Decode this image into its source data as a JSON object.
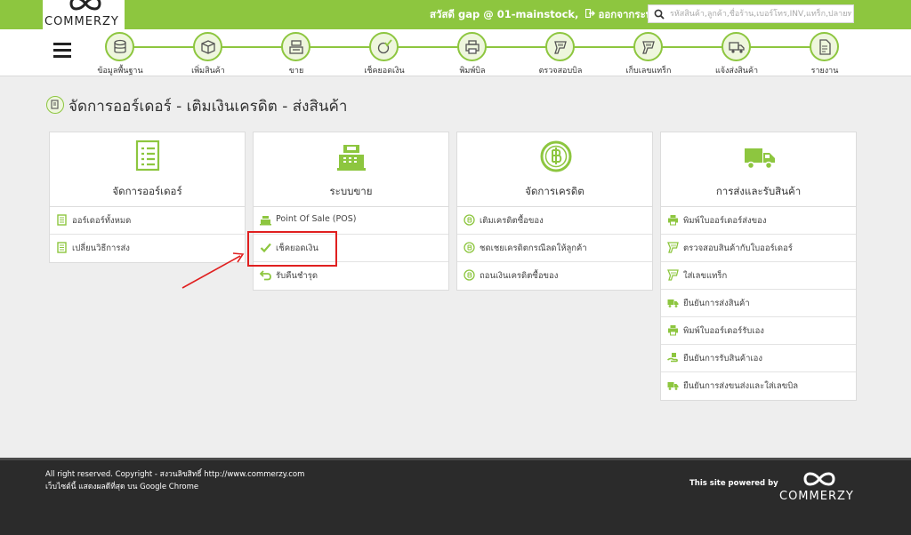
{
  "header": {
    "logo_text": "COMMERZY",
    "greeting": "สวัสดี gap @ 01-mainstock,",
    "logout": "ออกจากระบบ",
    "search_placeholder": "รหัสสินค้า,ลูกค้า,ชื่อร้าน,เบอร์โทร,INV,แทร็ก,ปลายทาง"
  },
  "nav": {
    "items": [
      {
        "label": "ข้อมูลพื้นฐาน",
        "icon": "database-icon"
      },
      {
        "label": "เพิ่มสินค้า",
        "icon": "box-icon"
      },
      {
        "label": "ขาย",
        "icon": "cash-register-icon"
      },
      {
        "label": "เช็คยอดเงิน",
        "icon": "money-check-icon"
      },
      {
        "label": "พิมพ์บิล",
        "icon": "printer-icon"
      },
      {
        "label": "ตรวจสอบบิล",
        "icon": "barcode-scanner-icon"
      },
      {
        "label": "เก็บเลขแทร็ก",
        "icon": "barcode-scanner-icon"
      },
      {
        "label": "แจ้งส่งสินค้า",
        "icon": "truck-icon"
      },
      {
        "label": "รายงาน",
        "icon": "report-icon"
      }
    ]
  },
  "page": {
    "title": "จัดการออร์เดอร์ - เติมเงินเครดิต - ส่งสินค้า"
  },
  "cards": [
    {
      "title": "จัดการออร์เดอร์",
      "icon": "document-list-icon",
      "rows": [
        {
          "label": "ออร์เดอร์ทั้งหมด",
          "icon": "document-icon"
        },
        {
          "label": "เปลี่ยนวิธีการส่ง",
          "icon": "document-icon"
        }
      ]
    },
    {
      "title": "ระบบขาย",
      "icon": "cash-register-icon",
      "rows": [
        {
          "label": "Point Of Sale (POS)",
          "icon": "cash-register-icon"
        },
        {
          "label": "เช็คยอดเงิน",
          "icon": "check-icon"
        },
        {
          "label": "รับคืนชำรุด",
          "icon": "return-icon"
        }
      ]
    },
    {
      "title": "จัดการเครดิต",
      "icon": "baht-coin-icon",
      "rows": [
        {
          "label": "เติมเครดิตซื้อของ",
          "icon": "baht-coin-icon"
        },
        {
          "label": "ชดเชยเครดิตกรณีลดให้ลูกค้า",
          "icon": "baht-coin-icon"
        },
        {
          "label": "ถอนเงินเครดิตซื้อของ",
          "icon": "baht-coin-icon"
        }
      ]
    },
    {
      "title": "การส่งและรับสินค้า",
      "icon": "truck-icon",
      "rows": [
        {
          "label": "พิมพ์ใบออร์เดอร์ส่งของ",
          "icon": "printer-icon"
        },
        {
          "label": "ตรวจสอบสินค้ากับใบออร์เดอร์",
          "icon": "barcode-scanner-icon"
        },
        {
          "label": "ใส่เลขแทร็ก",
          "icon": "barcode-scanner-icon"
        },
        {
          "label": "ยืนยันการส่งสินค้า",
          "icon": "truck-icon"
        },
        {
          "label": "พิมพ์ใบออร์เดอร์รับเอง",
          "icon": "printer-icon"
        },
        {
          "label": "ยืนยันการรับสินค้าเอง",
          "icon": "hand-box-icon"
        },
        {
          "label": "ยืนยันการส่งขนส่งและใส่เลขบิล",
          "icon": "truck-icon"
        }
      ]
    }
  ],
  "footer": {
    "copyright": "All right reserved. Copyright - สงวนลิขสิทธิ์ http://www.commerzy.com",
    "browser_note": "เว็บไซต์นี้ แสดงผลดีที่สุด บน Google Chrome",
    "powered_by": "This site powered by",
    "logo_text": "COMMERZY"
  },
  "colors": {
    "brand_green": "#8dc63f",
    "annotation_red": "#e02020",
    "footer_bg": "#2b2b2b"
  }
}
